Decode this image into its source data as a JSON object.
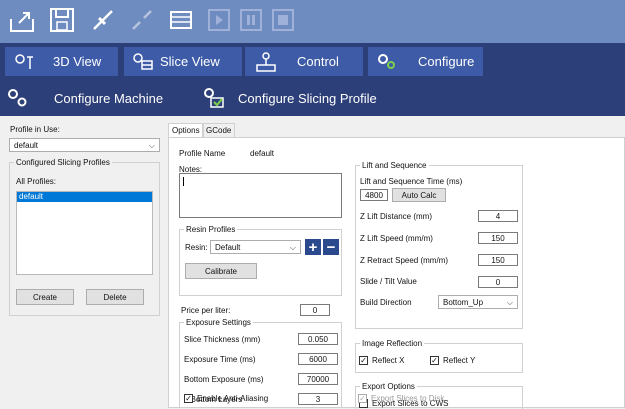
{
  "toolbar": {
    "icons": [
      "open-icon",
      "save-icon",
      "connect-icon",
      "disconnect-icon",
      "build-icon",
      "play-icon",
      "pause-icon",
      "stop-icon"
    ]
  },
  "view_tabs": [
    {
      "label": "3D View"
    },
    {
      "label": "Slice View"
    },
    {
      "label": "Control"
    },
    {
      "label": "Configure"
    }
  ],
  "config_tabs": [
    {
      "label": "Configure Machine"
    },
    {
      "label": "Configure Slicing Profile"
    }
  ],
  "left": {
    "profile_in_use_label": "Profile in Use:",
    "profile_value": "default",
    "configured_group": "Configured Slicing Profiles",
    "all_profiles_label": "All Profiles:",
    "profiles": [
      "default"
    ],
    "create_label": "Create",
    "delete_label": "Delete"
  },
  "subtabs": [
    "Options",
    "GCode"
  ],
  "options": {
    "profile_name_label": "Profile Name",
    "profile_name_value": "default",
    "notes_label": "Notes:",
    "resin_group": "Resin Profiles",
    "resin_label": "Resin:",
    "resin_value": "Default",
    "calibrate_label": "Calibrate",
    "price_label": "Price per liter:",
    "price_value": "0",
    "exposure_group": "Exposure Settings",
    "slice_thickness_label": "Slice Thickness (mm)",
    "slice_thickness_value": "0.050",
    "exposure_time_label": "Exposure Time (ms)",
    "exposure_time_value": "6000",
    "bottom_exposure_label": "Bottom Exposure (ms)",
    "bottom_exposure_value": "70000",
    "bottom_layers_label": "# Bottom Layers",
    "bottom_layers_value": "3",
    "anti_aliasing_label": "Enable Anti-Aliasing",
    "anti_aliasing_value": "3"
  },
  "lift": {
    "group": "Lift and Sequence",
    "time_label": "Lift and Sequence Time (ms)",
    "time_value": "4800",
    "auto_calc_label": "Auto Calc",
    "z_lift_distance_label": "Z Lift Distance (mm)",
    "z_lift_distance_value": "4",
    "z_lift_speed_label": "Z Lift Speed (mm/m)",
    "z_lift_speed_value": "150",
    "z_retract_speed_label": "Z Retract Speed (mm/m)",
    "z_retract_speed_value": "150",
    "slide_tilt_label": "Slide / Tilt Value",
    "slide_tilt_value": "0",
    "build_direction_label": "Build Direction",
    "build_direction_value": "Bottom_Up"
  },
  "reflection": {
    "group": "Image Reflection",
    "x_label": "Reflect X",
    "y_label": "Reflect Y"
  },
  "export": {
    "group": "Export Options",
    "cws_label": "Export Slices to CWS",
    "disk_label": "Export Slices to Disk"
  }
}
